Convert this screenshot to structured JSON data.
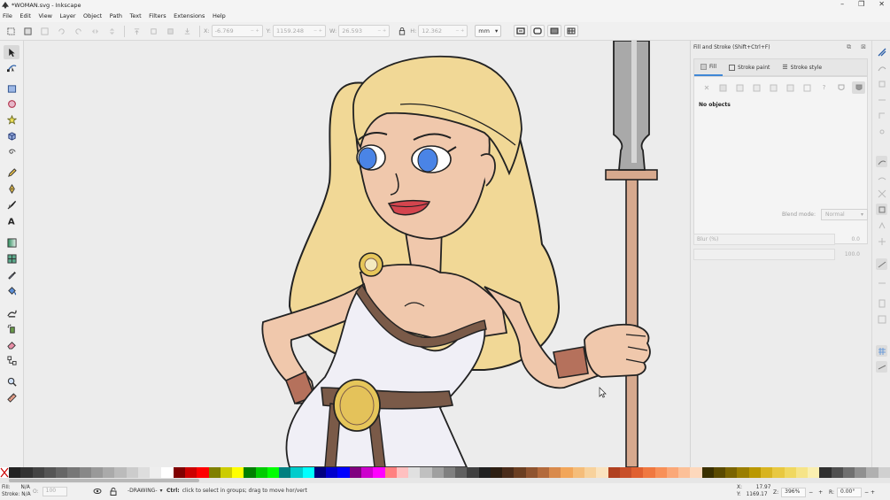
{
  "window": {
    "title": "*WOMAN.svg - Inkscape",
    "controls": [
      "–",
      "❐",
      "✕"
    ]
  },
  "menu": [
    "File",
    "Edit",
    "View",
    "Layer",
    "Object",
    "Path",
    "Text",
    "Filters",
    "Extensions",
    "Help"
  ],
  "toolbar": {
    "x": {
      "label": "X:",
      "value": "-6.769"
    },
    "y": {
      "label": "Y:",
      "value": "1159.248"
    },
    "w": {
      "label": "W:",
      "value": "26.593"
    },
    "h": {
      "label": "H:",
      "value": "12.362"
    },
    "unit": "mm"
  },
  "dock": {
    "title": "Fill and Stroke (Shift+Ctrl+F)",
    "tabs": [
      {
        "label": "Fill",
        "active": true
      },
      {
        "label": "Stroke paint",
        "active": false
      },
      {
        "label": "Stroke style",
        "active": false
      }
    ],
    "status": "No objects",
    "blend_label": "Blend mode:",
    "blend_value": "Normal",
    "blur_label": "Blur (%)",
    "blur_value": "0.0",
    "opacity_value": "100.0"
  },
  "statusbar": {
    "fill_label": "Fill:",
    "fill_value": "N/A",
    "stroke_label": "Stroke:",
    "stroke_value": "N/A",
    "opacity_label": "O:",
    "opacity_value": "100",
    "layer": "-DRAWING-",
    "message_key": "Ctrl:",
    "message": "click to select in groups; drag to move hor/vert",
    "x_label": "X:",
    "x_value": "17.97",
    "y_label": "Y:",
    "y_value": "1169.17",
    "zoom_label": "Z:",
    "zoom_value": "396%",
    "rotate_label": "R:",
    "rotate_value": "0.00°"
  },
  "colors": {
    "hair": "#f1d896",
    "skin": "#f0c8ac",
    "dress": "#f0eff6",
    "belt": "#7a5a48",
    "gold": "#e6c65a",
    "eye": "#4a84e6",
    "lips": "#d4454e",
    "spear_wood": "#d7a98e",
    "spear_blade": "#a9a9a9",
    "bracer": "#b5715c"
  },
  "palette": [
    "#222222",
    "#333333",
    "#444444",
    "#555555",
    "#666666",
    "#777777",
    "#888888",
    "#999999",
    "#aaaaaa",
    "#bbbbbb",
    "#cccccc",
    "#dddddd",
    "#eeeeee",
    "#ffffff",
    "#800000",
    "#cc0000",
    "#ff0000",
    "#808000",
    "#cccc00",
    "#ffff00",
    "#008000",
    "#00cc00",
    "#00ff00",
    "#008080",
    "#00cccc",
    "#00ffff",
    "#000080",
    "#0000cc",
    "#0000ff",
    "#800080",
    "#cc00cc",
    "#ff00ff",
    "#ff8080",
    "#ffc0c0",
    "#e0e0e0",
    "#c0c0c0",
    "#a0a0a0",
    "#808080",
    "#606060",
    "#404040",
    "#202020",
    "#2d1e12",
    "#4a2c1a",
    "#6b3f22",
    "#8f5430",
    "#b36a3c",
    "#d98a4c",
    "#f2a65a",
    "#f5bd7a",
    "#f8d29c",
    "#fae3bf",
    "#b04020",
    "#c8502a",
    "#e06030",
    "#f07840",
    "#f89058",
    "#fba878",
    "#fcc098",
    "#fdd8bc",
    "#3a3000",
    "#5a4a00",
    "#7a6400",
    "#9a7e00",
    "#ba9800",
    "#d8b420",
    "#e8c840",
    "#f0d860",
    "#f6e488",
    "#faefb0",
    "#303030",
    "#505050",
    "#707070",
    "#909090",
    "#b0b0b0",
    "#d0d0d0"
  ]
}
